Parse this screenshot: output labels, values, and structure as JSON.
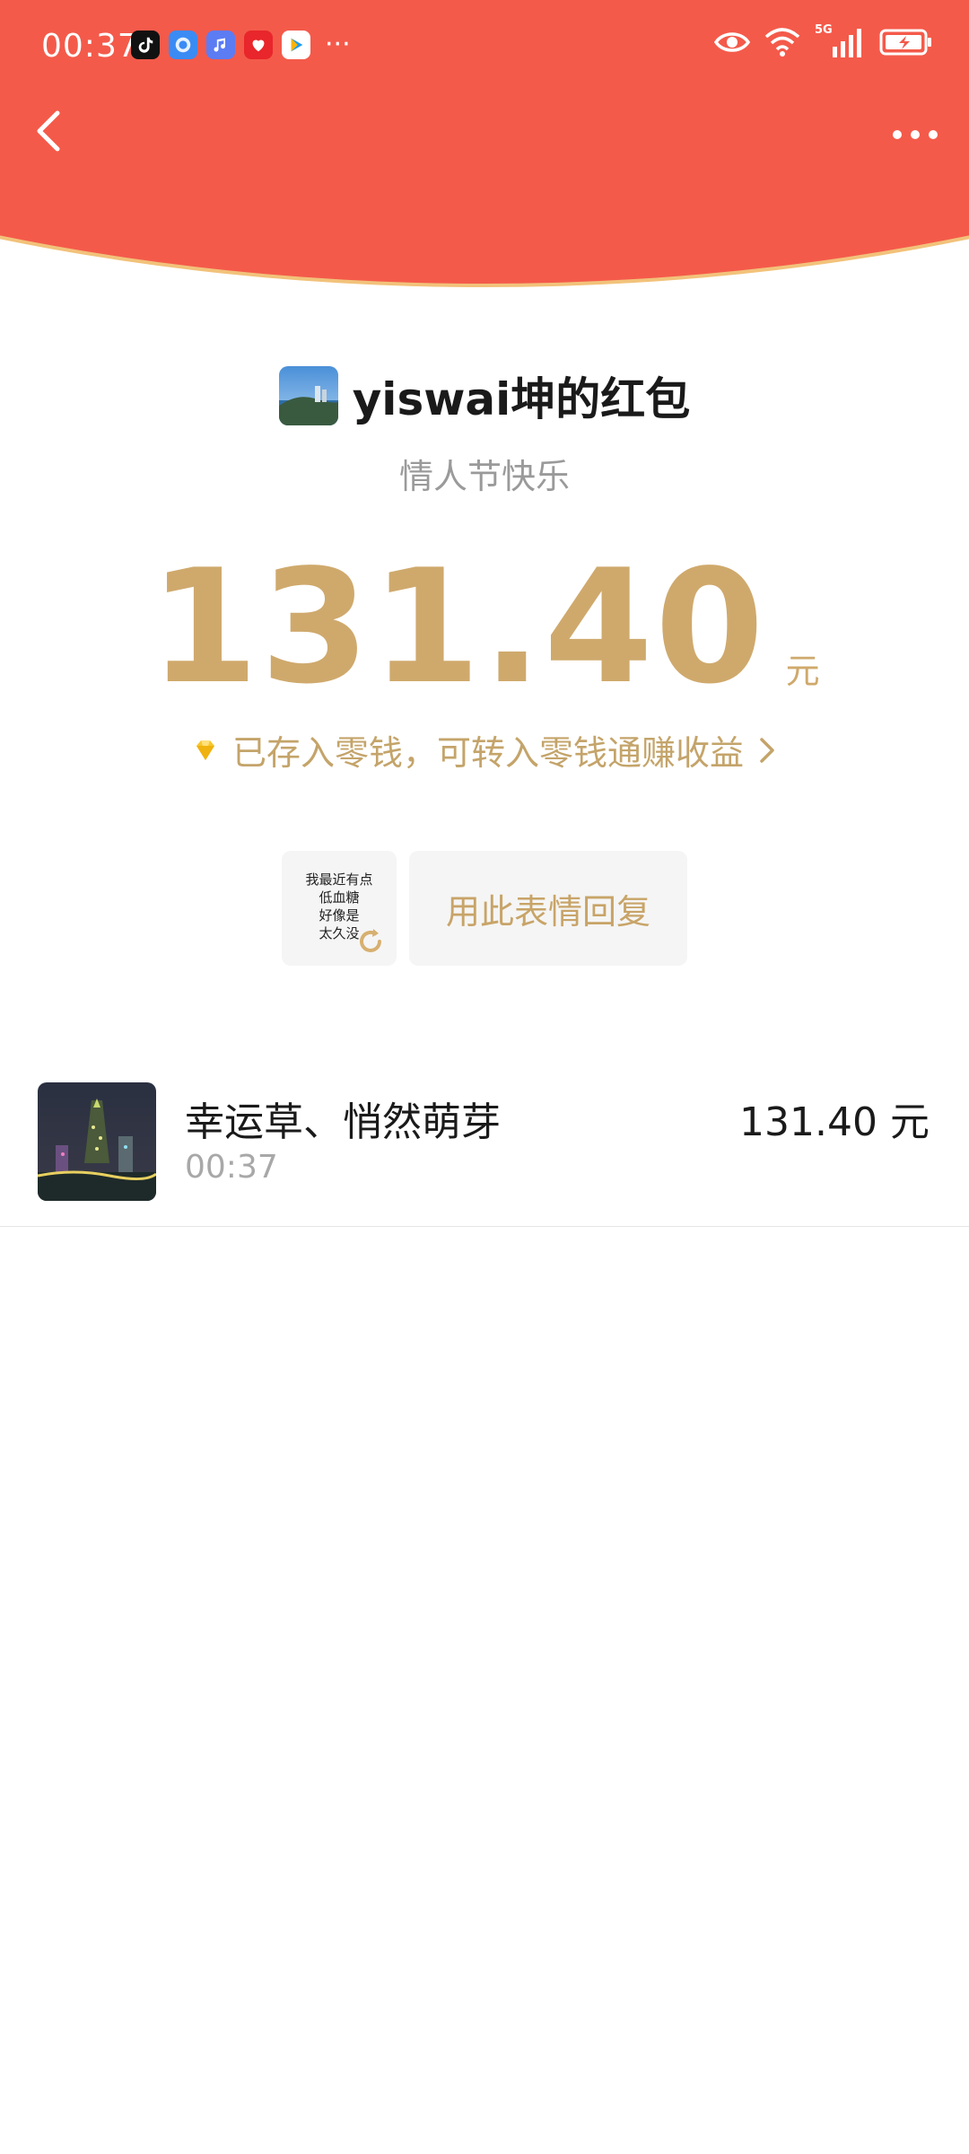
{
  "status_bar": {
    "time": "00:37",
    "notification_icons": [
      "tiktok-icon",
      "browser-icon",
      "music-icon",
      "health-icon",
      "video-icon"
    ],
    "overflow": "···",
    "network_label": "5G",
    "indicators": [
      "eye-icon",
      "wifi-icon",
      "signal-icon",
      "battery-icon"
    ]
  },
  "nav": {
    "back_icon": "chevron-left-icon",
    "more_icon": "more-horizontal-icon"
  },
  "envelope": {
    "sender_title": "yiswai坤的红包",
    "greeting": "情人节快乐",
    "amount": "131.40",
    "unit": "元",
    "stored_notice": "已存入零钱，可转入零钱通赚收益"
  },
  "sticker": {
    "text": "我最近有点\n低血糖\n好像是\n太久没",
    "refresh_icon": "refresh-icon"
  },
  "reply": {
    "label": "用此表情回复"
  },
  "records": [
    {
      "name": "幸运草、悄然萌芽",
      "time": "00:37",
      "amount": "131.40 元"
    }
  ],
  "colors": {
    "header_red": "#F45A4A",
    "header_border": "#F2C27A",
    "gold": "#CFA96C",
    "gray_text": "#9a9a9a"
  }
}
